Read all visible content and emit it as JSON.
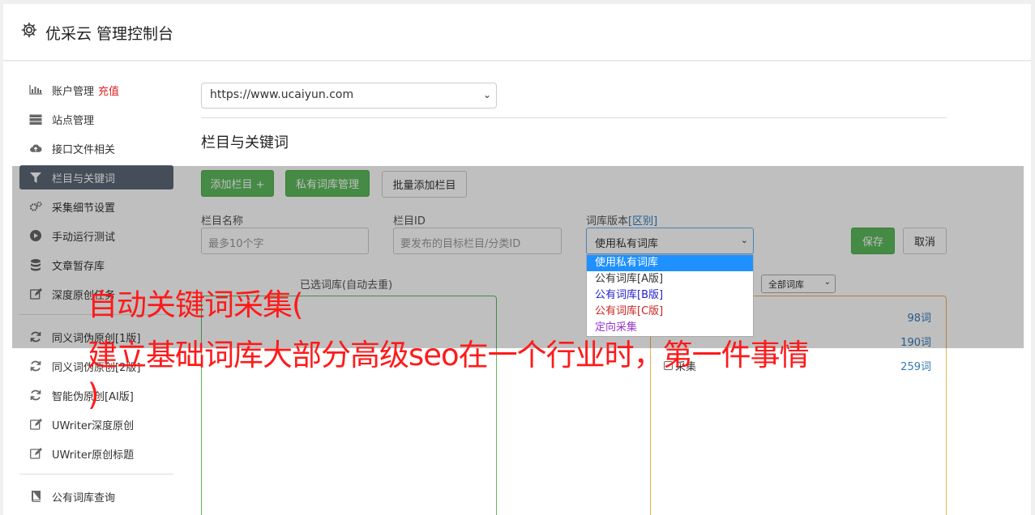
{
  "header": {
    "title": "优采云 管理控制台",
    "icon": "gear-icon"
  },
  "sidebar": {
    "group1": [
      {
        "label": "账户管理",
        "extra": "充值",
        "icon": "bar-chart-icon"
      },
      {
        "label": "站点管理",
        "icon": "server-icon"
      },
      {
        "label": "接口文件相关",
        "icon": "cloud-upload-icon"
      },
      {
        "label": "栏目与关键词",
        "icon": "filter-icon",
        "active": true
      },
      {
        "label": "采集细节设置",
        "icon": "gears-icon"
      },
      {
        "label": "手动运行测试",
        "icon": "play-circle-icon"
      },
      {
        "label": "文章暂存库",
        "icon": "database-icon"
      },
      {
        "label": "深度原创任务",
        "icon": "edit-icon"
      }
    ],
    "group2": [
      {
        "label": "同义词伪原创[1版]",
        "icon": "refresh-icon"
      },
      {
        "label": "同义词伪原创[2版]",
        "icon": "refresh-icon"
      },
      {
        "label": "智能伪原创[AI版]",
        "icon": "refresh-icon"
      },
      {
        "label": "UWriter深度原创",
        "icon": "edit-icon"
      },
      {
        "label": "UWriter原创标题",
        "icon": "edit-icon"
      }
    ],
    "group3": [
      {
        "label": "公有词库查询",
        "icon": "book-icon"
      }
    ]
  },
  "main": {
    "site_select": "https://www.ucaiyun.com",
    "section_title": "栏目与关键词",
    "buttons": {
      "add_column": "添加栏目 +",
      "private_lib": "私有词库管理",
      "batch_add": "批量添加栏目",
      "save": "保存",
      "cancel": "取消"
    },
    "fields": {
      "column_name_label": "栏目名称",
      "column_name_placeholder": "最多10个字",
      "column_id_label": "栏目ID",
      "column_id_placeholder": "要发布的目标栏目/分类ID",
      "lib_version_label": "词库版本",
      "lib_version_link": "[区别]",
      "lib_version_value": "使用私有词库"
    },
    "dropdown_options": [
      {
        "label": "使用私有词库",
        "color": "#ffffff",
        "selected": true
      },
      {
        "label": "公有词库[A版]",
        "color": "#333333"
      },
      {
        "label": "公有词库[B版]",
        "color": "#2222cc"
      },
      {
        "label": "公有词库[C版]",
        "color": "#cc2222"
      },
      {
        "label": "定向采集",
        "color": "#9933cc"
      }
    ],
    "left_pane_title": "已选词库(自动去重)",
    "right_select": "全部词库",
    "right_pane": {
      "count1": "98词",
      "count2": "190词",
      "row2_label": "采集",
      "count3": "259词"
    }
  },
  "watermark": {
    "line1": "自动关键词采集(",
    "line2": "建立基础词库大部分高级seo在一个行业时，第一件事情",
    "line3": ")"
  }
}
